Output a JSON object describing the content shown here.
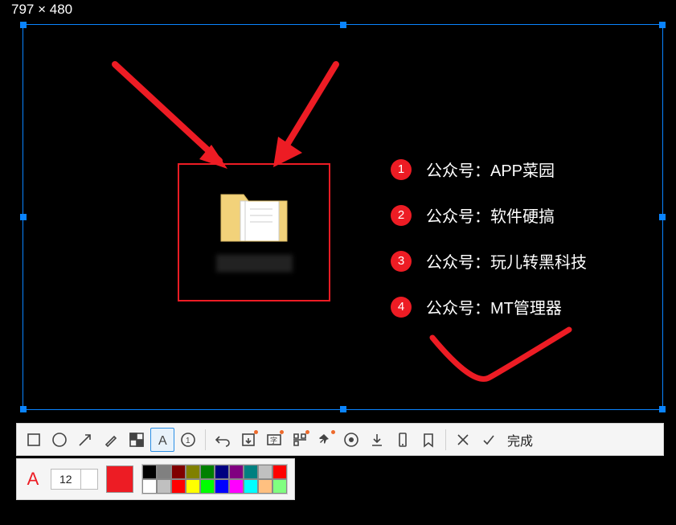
{
  "dimensions_label": "797 × 480",
  "canvas": {
    "folder_label_hidden": "████████"
  },
  "annotations": [
    {
      "badge": "1",
      "text": "公众号：APP菜园"
    },
    {
      "badge": "2",
      "text": "公众号：软件硬搞"
    },
    {
      "badge": "3",
      "text": "公众号：玩儿转黑科技"
    },
    {
      "badge": "4",
      "text": "公众号：MT管理器"
    }
  ],
  "toolbar": {
    "done_label": "完成",
    "active_tool": "text"
  },
  "style_panel": {
    "indicator": "A",
    "font_size": "12",
    "current_color": "#ed1c24",
    "palette": [
      "#000000",
      "#808080",
      "#800000",
      "#808000",
      "#008000",
      "#000080",
      "#800080",
      "#008080",
      "#c0c0c0",
      "#ff0000",
      "#ffffff",
      "#c0c0c0",
      "#ff0000",
      "#ffff00",
      "#00ff00",
      "#0000ff",
      "#ff00ff",
      "#00ffff",
      "#ffc080",
      "#80ff80"
    ]
  }
}
